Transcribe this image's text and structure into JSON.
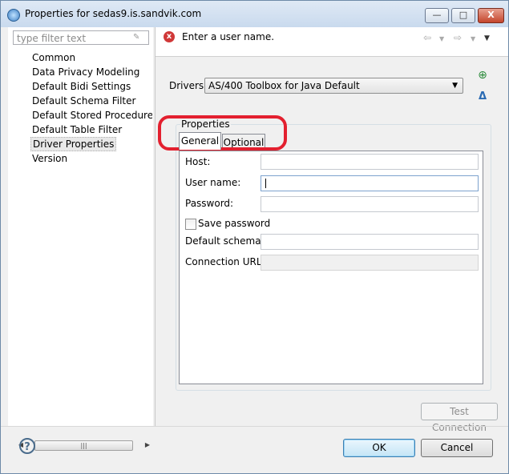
{
  "window": {
    "title": "Properties for sedas9.is.sandvik.com",
    "min_label": "—",
    "max_label": "□",
    "close_label": "X"
  },
  "sidebar": {
    "filter_placeholder": "type filter text",
    "items": [
      {
        "label": "Common"
      },
      {
        "label": "Data Privacy Modeling"
      },
      {
        "label": "Default Bidi Settings"
      },
      {
        "label": "Default Schema Filter"
      },
      {
        "label": "Default Stored Procedure F"
      },
      {
        "label": "Default Table Filter"
      },
      {
        "label": "Driver Properties",
        "selected": true
      },
      {
        "label": "Version"
      }
    ]
  },
  "message": {
    "text": "Enter a user name.",
    "type": "error"
  },
  "drivers": {
    "label": "Drivers:",
    "selected": "AS/400 Toolbox for Java Default"
  },
  "properties": {
    "group_label": "Properties",
    "tabs": [
      {
        "label": "General",
        "active": true
      },
      {
        "label": "Optional",
        "active": false
      }
    ],
    "fields": {
      "host_label": "Host:",
      "host_value": "",
      "user_label": "User name:",
      "user_value": "",
      "password_label": "Password:",
      "password_value": "",
      "save_password_label": "Save password",
      "save_password_checked": false,
      "schema_label": "Default schema:",
      "schema_value": "",
      "url_label": "Connection URL:",
      "url_value": ""
    }
  },
  "buttons": {
    "test_connection": "Test Connection",
    "ok": "OK",
    "cancel": "Cancel"
  },
  "icons": {
    "help": "?",
    "error": "x"
  },
  "colors": {
    "annotation": "#e3202f",
    "accent": "#3c7fb1"
  }
}
